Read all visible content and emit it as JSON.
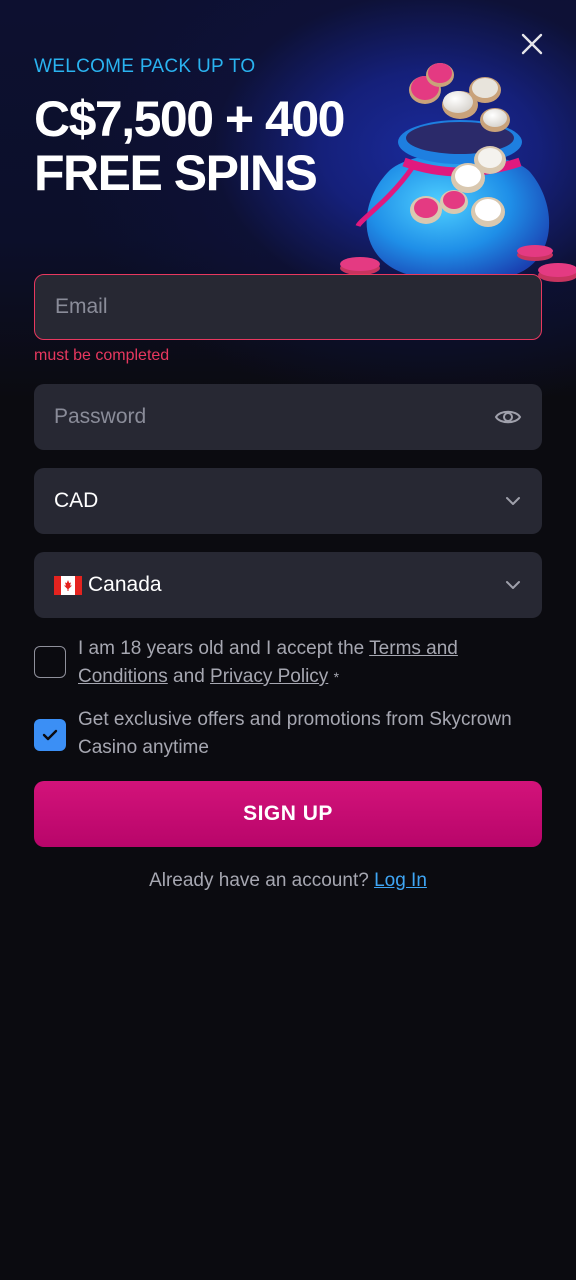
{
  "promo": {
    "kicker": "WELCOME PACK UP TO",
    "headline_line1": "C$7,500 + 400",
    "headline_line2": "FREE SPINS"
  },
  "form": {
    "email": {
      "placeholder": "Email",
      "value": "",
      "error": "must be completed"
    },
    "password": {
      "placeholder": "Password",
      "value": ""
    },
    "currency": {
      "value": "CAD"
    },
    "country": {
      "value": "Canada"
    },
    "terms": {
      "checked": false,
      "text_before": "I am 18 years old and I accept the ",
      "terms_link": "Terms and Conditions",
      "text_between": " and ",
      "privacy_link": "Privacy Policy",
      "required_mark": "*"
    },
    "promotions": {
      "checked": true,
      "text": "Get exclusive offers and promotions from Skycrown Casino anytime"
    },
    "submit_label": "SIGN UP"
  },
  "footer": {
    "prompt": "Already have an account?",
    "login_link": "Log In"
  },
  "icons": {
    "close": "close-icon",
    "eye": "eye-icon",
    "chevron": "chevron-down-icon",
    "flag": "canada-flag-icon",
    "check": "checkmark-icon"
  },
  "colors": {
    "background": "#0b0b10",
    "field": "#272833",
    "accent_blue": "#2ab3f0",
    "error": "#e8385f",
    "primary_button": "#d3137a",
    "link": "#3fa6f5",
    "checkbox_on": "#3b8ff5"
  }
}
